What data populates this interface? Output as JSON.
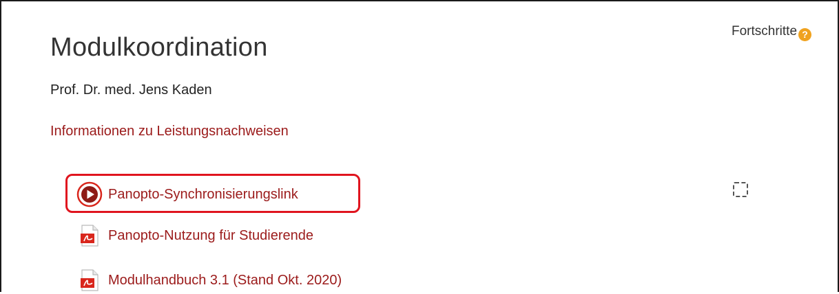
{
  "section": {
    "title": "Modulkoordination",
    "summary": "Prof. Dr. med. Jens Kaden",
    "info_link": "Informationen zu Leistungsnachweisen"
  },
  "progress": {
    "label": "Fortschritte",
    "help_glyph": "?"
  },
  "activities": [
    {
      "label": "Panopto-Synchronisierungslink",
      "icon": "panopto-play-icon",
      "highlighted": true,
      "completion_checkbox": true
    },
    {
      "label": "Panopto-Nutzung für Studierende",
      "icon": "pdf-file-icon"
    },
    {
      "label": "Modulhandbuch 3.1 (Stand Okt. 2020)",
      "icon": "pdf-file-icon"
    }
  ],
  "colors": {
    "link": "#9b1a1a",
    "highlight_border": "#e0141e",
    "help_icon": "#f0a21e",
    "pdf_red": "#d9261c"
  }
}
